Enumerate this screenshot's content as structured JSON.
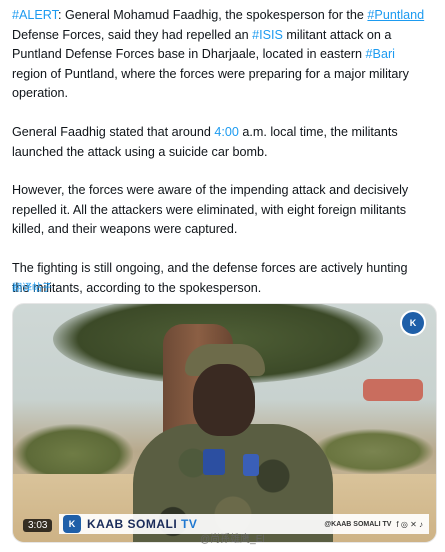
{
  "post": {
    "p1": {
      "tag_alert": "#ALERT",
      "t1": ": General Mohamud Faadhig, the spokesperson for the ",
      "tag_puntland": "#Puntland",
      "t2": " Defense Forces, said they had repelled an ",
      "tag_isis": "#ISIS",
      "t3": " militant attack on a Puntland Defense Forces base in Dharjaale, located in eastern ",
      "tag_bari": "#Bari",
      "t4": " region of Puntland, where the forces were preparing for a major military operation."
    },
    "p2": {
      "t1": "General Faadhig stated that around ",
      "time": "4:00",
      "t2": " a.m. local time, the militants launched the attack using a suicide car bomb."
    },
    "p3": "However, the forces were aware of the impending attack and decisively repelled it. All the attackers were eliminated, with eight foreign militants killed, and their weapons were captured.",
    "p4": "The fighting is still ongoing, and the defense forces are actively hunting the militants, according to the spokesperson.",
    "translate_label": "翻译帖子"
  },
  "video": {
    "duration": "3:03",
    "brand_main": "KAAB SOMALI",
    "brand_tv": "TV",
    "handle": "@KAAB SOMALI TV",
    "social_icons": "f ◎ ✕ ♪"
  },
  "watermark": "@尚孫雄鹰_El"
}
